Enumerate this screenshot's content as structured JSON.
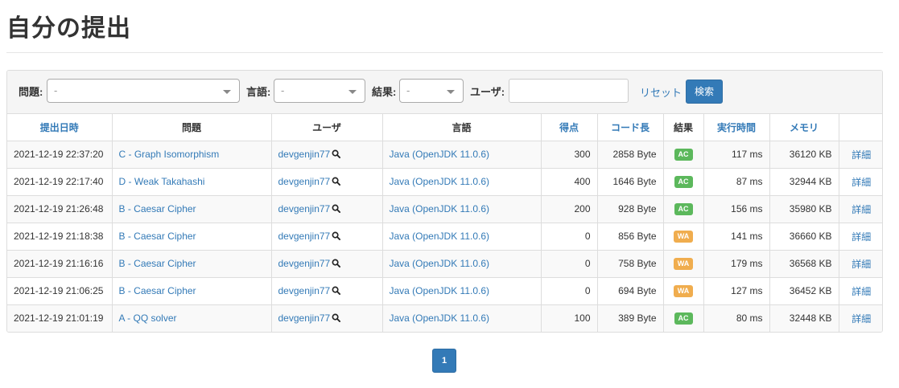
{
  "page": {
    "title": "自分の提出"
  },
  "filters": {
    "task_label": "問題:",
    "task_value": "-",
    "language_label": "言語:",
    "language_value": "-",
    "result_label": "結果:",
    "result_value": "-",
    "user_label": "ユーザ:",
    "user_value": "",
    "reset_label": "リセット",
    "search_label": "検索"
  },
  "table": {
    "headers": [
      "提出日時",
      "問題",
      "ユーザ",
      "言語",
      "得点",
      "コード長",
      "結果",
      "実行時間",
      "メモリ",
      ""
    ],
    "rows": [
      {
        "time": "2021-12-19 22:37:20",
        "task": "C - Graph Isomorphism",
        "user": "devgenjin77",
        "lang": "Java (OpenJDK 11.0.6)",
        "score": "300",
        "code": "2858 Byte",
        "result": "AC",
        "exec": "117 ms",
        "mem": "36120 KB",
        "detail": "詳細"
      },
      {
        "time": "2021-12-19 22:17:40",
        "task": "D - Weak Takahashi",
        "user": "devgenjin77",
        "lang": "Java (OpenJDK 11.0.6)",
        "score": "400",
        "code": "1646 Byte",
        "result": "AC",
        "exec": "87 ms",
        "mem": "32944 KB",
        "detail": "詳細"
      },
      {
        "time": "2021-12-19 21:26:48",
        "task": "B - Caesar Cipher",
        "user": "devgenjin77",
        "lang": "Java (OpenJDK 11.0.6)",
        "score": "200",
        "code": "928 Byte",
        "result": "AC",
        "exec": "156 ms",
        "mem": "35980 KB",
        "detail": "詳細"
      },
      {
        "time": "2021-12-19 21:18:38",
        "task": "B - Caesar Cipher",
        "user": "devgenjin77",
        "lang": "Java (OpenJDK 11.0.6)",
        "score": "0",
        "code": "856 Byte",
        "result": "WA",
        "exec": "141 ms",
        "mem": "36660 KB",
        "detail": "詳細"
      },
      {
        "time": "2021-12-19 21:16:16",
        "task": "B - Caesar Cipher",
        "user": "devgenjin77",
        "lang": "Java (OpenJDK 11.0.6)",
        "score": "0",
        "code": "758 Byte",
        "result": "WA",
        "exec": "179 ms",
        "mem": "36568 KB",
        "detail": "詳細"
      },
      {
        "time": "2021-12-19 21:06:25",
        "task": "B - Caesar Cipher",
        "user": "devgenjin77",
        "lang": "Java (OpenJDK 11.0.6)",
        "score": "0",
        "code": "694 Byte",
        "result": "WA",
        "exec": "127 ms",
        "mem": "36452 KB",
        "detail": "詳細"
      },
      {
        "time": "2021-12-19 21:01:19",
        "task": "A - QQ solver",
        "user": "devgenjin77",
        "lang": "Java (OpenJDK 11.0.6)",
        "score": "100",
        "code": "389 Byte",
        "result": "AC",
        "exec": "80 ms",
        "mem": "32448 KB",
        "detail": "詳細"
      }
    ]
  },
  "pagination": {
    "current": "1"
  },
  "colors": {
    "link": "#337ab7",
    "ac": "#5cb85c",
    "wa": "#f0ad4e",
    "primary": "#337ab7"
  }
}
